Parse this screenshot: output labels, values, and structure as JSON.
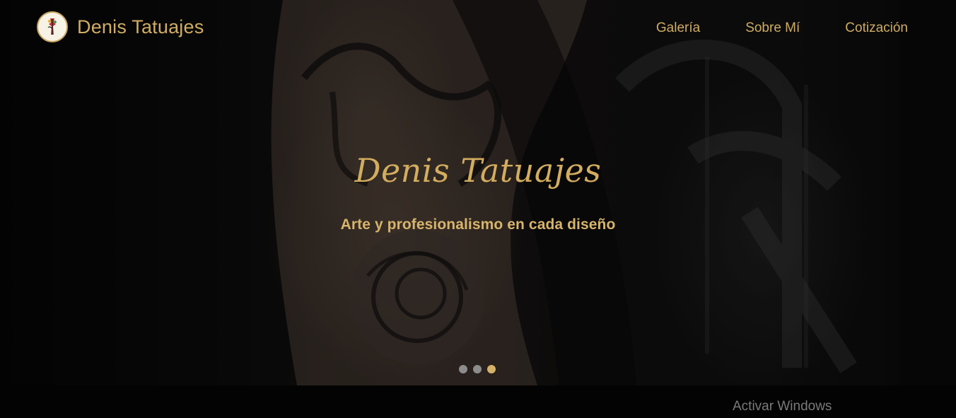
{
  "site": {
    "brand_name": "Denis Tatuajes",
    "logo_icon": "tattoo-logo-icon"
  },
  "nav": {
    "items": [
      {
        "label": "Galería"
      },
      {
        "label": "Sobre Mí"
      },
      {
        "label": "Cotización"
      }
    ]
  },
  "hero": {
    "title": "Denis Tatuajes",
    "subtitle": "Arte y profesionalismo en cada diseño",
    "slides_count": 3,
    "active_slide": 3
  },
  "os_overlay": {
    "watermark": "Activar Windows"
  },
  "colors": {
    "accent_gold": "#d1ad62",
    "indicator_inactive": "#8c8c8c",
    "background": "#000000"
  }
}
